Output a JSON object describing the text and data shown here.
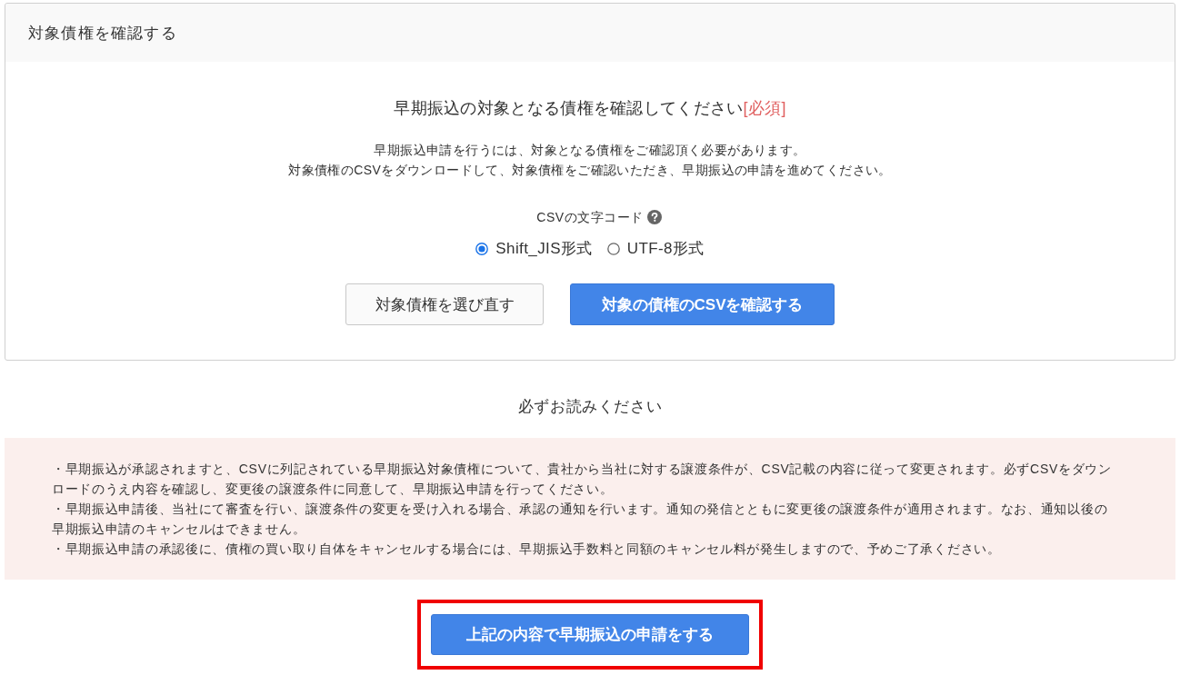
{
  "panel": {
    "title": "対象債権を確認する",
    "heading": "早期振込の対象となる債権を確認してください",
    "required_mark": "[必須]",
    "description": [
      "早期振込申請を行うには、対象となる債権をご確認頂く必要があります。",
      "対象債権のCSVをダウンロードして、対象債権をご確認いただき、早期振込の申請を進めてください。"
    ],
    "encoding": {
      "label": "CSVの文字コード",
      "options": [
        {
          "label": "Shift_JIS形式",
          "selected": true
        },
        {
          "label": "UTF-8形式",
          "selected": false
        }
      ]
    },
    "buttons": [
      {
        "label": "対象債権を選び直す",
        "kind": "secondary"
      },
      {
        "label": "対象の債権のCSVを確認する",
        "kind": "primary"
      }
    ]
  },
  "notice": {
    "title": "必ずお読みください",
    "items": [
      "・早期振込が承認されますと、CSVに列記されている早期振込対象債権について、貴社から当社に対する譲渡条件が、CSV記載の内容に従って変更されます。必ずCSVをダウンロードのうえ内容を確認し、変更後の譲渡条件に同意して、早期振込申請を行ってください。",
      "・早期振込申請後、当社にて審査を行い、譲渡条件の変更を受け入れる場合、承認の通知を行います。通知の発信とともに変更後の譲渡条件が適用されます。なお、通知以後の早期振込申請のキャンセルはできません。",
      "・早期振込申請の承認後に、債権の買い取り自体をキャンセルする場合には、早期振込手数料と同額のキャンセル料が発生しますので、予めご了承ください。"
    ]
  },
  "submit": {
    "label": "上記の内容で早期振込の申請をする",
    "highlighted": true
  }
}
